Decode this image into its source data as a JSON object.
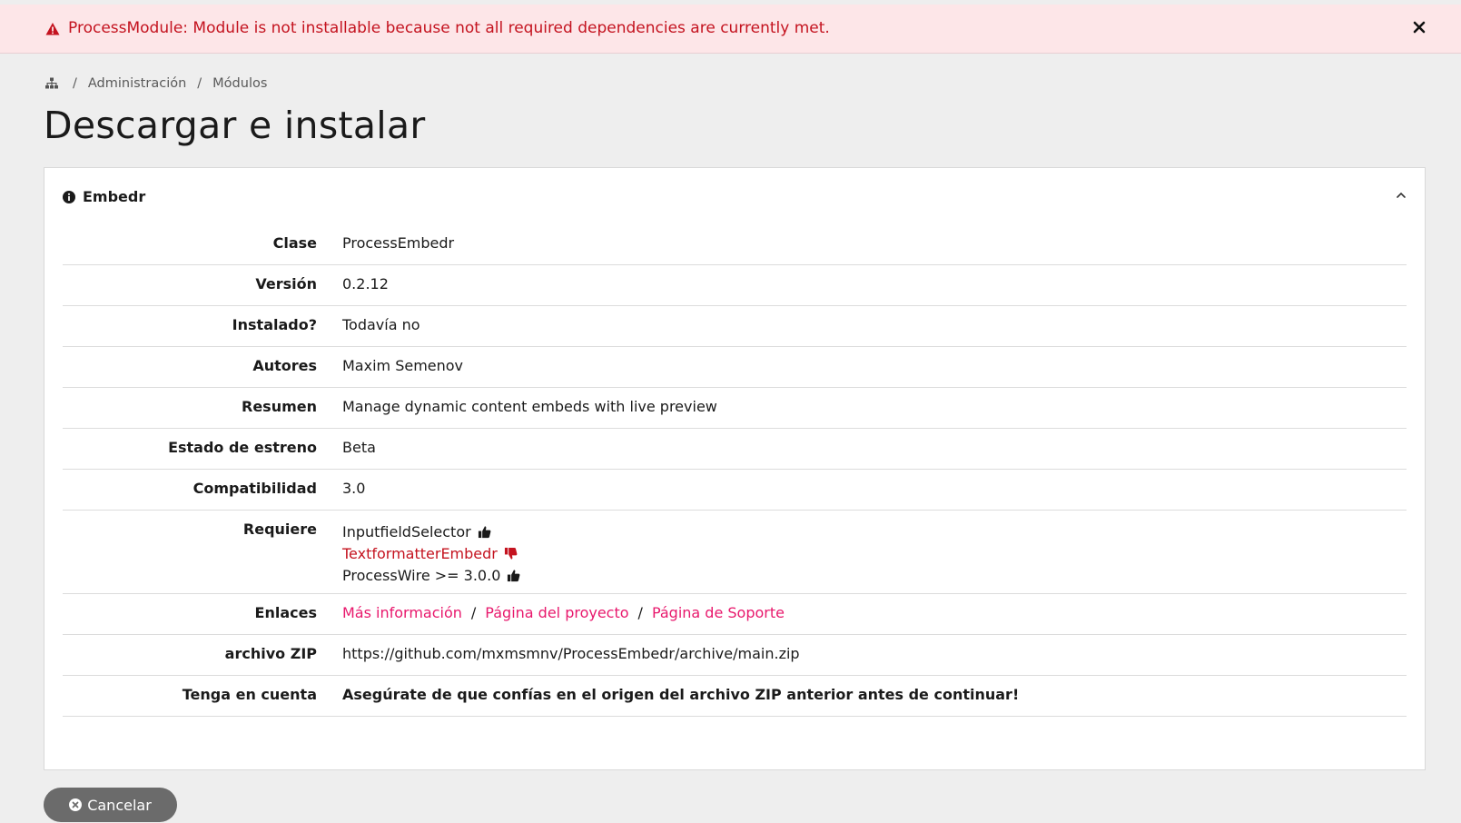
{
  "alert": {
    "message": "ProcessModule: Module is not installable because not all required dependencies are currently met.",
    "icon": "warning-icon",
    "close_icon": "close-icon",
    "color": "#c4131f",
    "background": "#fde6e8"
  },
  "breadcrumb": {
    "home_icon": "sitemap-icon",
    "items": [
      "Administración",
      "Módulos"
    ],
    "separator": "/"
  },
  "page_title": "Descargar e instalar",
  "panel": {
    "title": "Embedr",
    "icon": "info-icon",
    "toggle_icon": "chevron-up-icon",
    "rows": {
      "clase": {
        "label": "Clase",
        "value": "ProcessEmbedr"
      },
      "version": {
        "label": "Versión",
        "value": "0.2.12"
      },
      "instalado": {
        "label": "Instalado?",
        "value": "Todavía no"
      },
      "autores": {
        "label": "Autores",
        "value": "Maxim Semenov"
      },
      "resumen": {
        "label": "Resumen",
        "value": "Manage dynamic content embeds with live preview"
      },
      "estado": {
        "label": "Estado de estreno",
        "value": "Beta"
      },
      "compat": {
        "label": "Compatibilidad",
        "value": "3.0"
      },
      "requiere": {
        "label": "Requiere",
        "items": [
          {
            "name": "InputfieldSelector",
            "status": "thumbs-up-icon",
            "met": true
          },
          {
            "name": "TextformatterEmbedr",
            "status": "thumbs-down-icon",
            "met": false
          },
          {
            "name": "ProcessWire >= 3.0.0",
            "status": "thumbs-up-icon",
            "met": true
          }
        ]
      },
      "enlaces": {
        "label": "Enlaces",
        "links": [
          "Más información",
          "Página del proyecto",
          "Página de Soporte"
        ],
        "separator": "/"
      },
      "zip": {
        "label": "archivo ZIP",
        "value": "https://github.com/mxmsmnv/ProcessEmbedr/archive/main.zip"
      },
      "nota": {
        "label": "Tenga en cuenta",
        "value": "Asegúrate de que confías en el origen del archivo ZIP anterior antes de continuar!"
      }
    }
  },
  "cancel_button": {
    "label": "Cancelar",
    "icon": "circle-x-icon"
  },
  "colors": {
    "link": "#e8186c",
    "danger": "#c4131f",
    "button": "#6b6b6b",
    "page_bg": "#eeeeee"
  }
}
